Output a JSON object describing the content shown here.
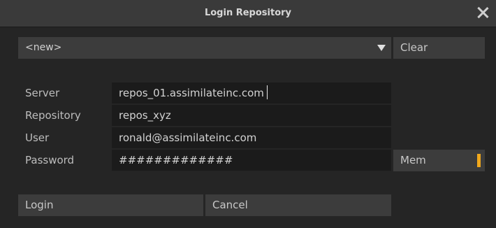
{
  "window": {
    "title": "Login Repository"
  },
  "profile_select": {
    "value": "<new>"
  },
  "buttons": {
    "clear": "Clear",
    "mem": "Mem",
    "login": "Login",
    "cancel": "Cancel"
  },
  "form": {
    "server": {
      "label": "Server",
      "value": "repos_01.assimilateinc.com"
    },
    "repository": {
      "label": "Repository",
      "value": "repos_xyz"
    },
    "user": {
      "label": "User",
      "value": "ronald@assimilateinc.com"
    },
    "password": {
      "label": "Password",
      "value": "#############"
    }
  },
  "colors": {
    "background": "#252525",
    "titlebar": "#3a3a3a",
    "field": "#1b1b1b",
    "button": "#3c3c3c",
    "mem_indicator": "#f0a81c"
  },
  "icons": {
    "close": "close-icon",
    "dropdown": "chevron-down-icon"
  }
}
